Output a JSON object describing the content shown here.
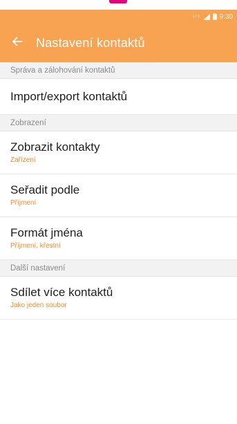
{
  "colors": {
    "accent": "#f7a352",
    "secondary_text": "#f08a2b",
    "pink_mark": "#e6007e"
  },
  "status_bar": {
    "network": "LTE",
    "time": "9:30"
  },
  "app_bar": {
    "back_icon": "arrow-left-icon",
    "title": "Nastavení kontaktů"
  },
  "sections": [
    {
      "header": "Správa a zálohování kontaktů",
      "items": [
        {
          "title": "Import/export kontaktů",
          "subtitle": ""
        }
      ]
    },
    {
      "header": "Zobrazení",
      "items": [
        {
          "title": "Zobrazit kontakty",
          "subtitle": "Zařízení"
        },
        {
          "title": "Seřadit podle",
          "subtitle": "Příjmení"
        },
        {
          "title": "Formát jména",
          "subtitle": "Příjmení, křestní"
        }
      ]
    },
    {
      "header": "Další nastavení",
      "items": [
        {
          "title": "Sdílet více kontaktů",
          "subtitle": "Jako jeden soubor"
        }
      ]
    }
  ]
}
